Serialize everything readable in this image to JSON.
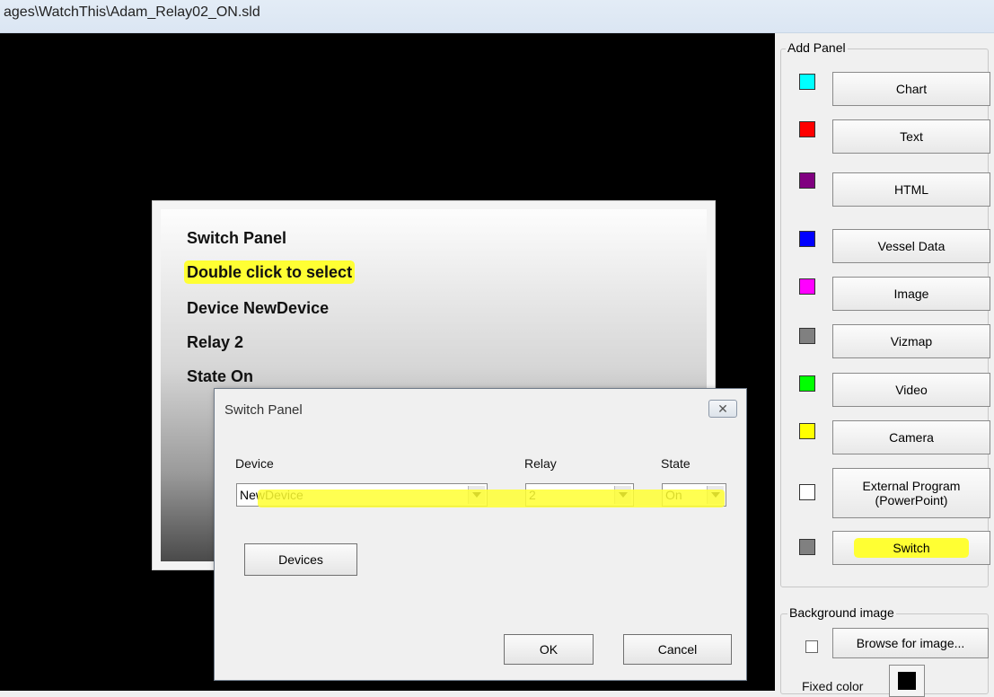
{
  "window": {
    "path": "ages\\WatchThis\\Adam_Relay02_ON.sld"
  },
  "slide": {
    "lines": [
      "Switch Panel",
      "Double click to select",
      "Device NewDevice",
      "Relay 2",
      "State On"
    ]
  },
  "dialog": {
    "title": "Switch Panel",
    "close_glyph": "✕",
    "device_label": "Device",
    "device_value": "NewDevice",
    "relay_label": "Relay",
    "relay_value": "2",
    "state_label": "State",
    "state_value": "On",
    "devices_button": "Devices",
    "ok_button": "OK",
    "cancel_button": "Cancel"
  },
  "add_panel": {
    "title": "Add Panel",
    "items": [
      {
        "label": "Chart",
        "color": "#00ffff"
      },
      {
        "label": "Text",
        "color": "#ff0000"
      },
      {
        "label": "HTML",
        "color": "#800080"
      },
      {
        "label": "Vessel Data",
        "color": "#0000ff"
      },
      {
        "label": "Image",
        "color": "#ff00ff"
      },
      {
        "label": "Vizmap",
        "color": "#808080"
      },
      {
        "label": "Video",
        "color": "#00ff00"
      },
      {
        "label": "Camera",
        "color": "#ffff00"
      },
      {
        "label_line1": "External Program",
        "label_line2": "(PowerPoint)",
        "color": "#ffffff"
      },
      {
        "label": "Switch",
        "color": "#808080"
      }
    ]
  },
  "background_image": {
    "title": "Background image",
    "browse_button": "Browse for image...",
    "fixed_color_label": "Fixed color",
    "fixed_color": "#000000"
  },
  "highlight_color": "#ffff33"
}
